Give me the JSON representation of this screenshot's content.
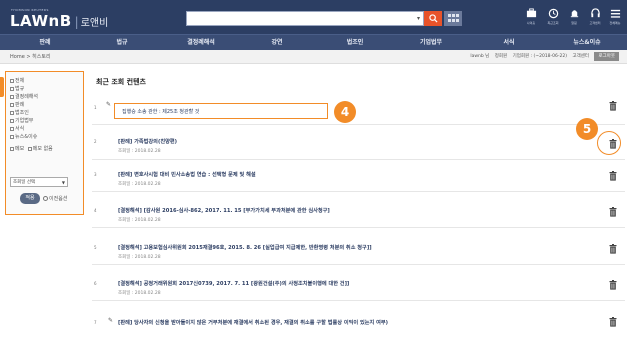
{
  "header": {
    "brand_tagline": "THOMSON REUTERS",
    "brand_name": "LAWnB",
    "brand_sep": "|",
    "brand_korean": "로앤비",
    "tools": [
      {
        "icon": "briefcase-icon",
        "label": "나의홈"
      },
      {
        "icon": "history-icon",
        "label": "최근조회"
      },
      {
        "icon": "bell-icon",
        "label": "알림"
      },
      {
        "icon": "headset-icon",
        "label": "고객센터"
      },
      {
        "icon": "menu-icon",
        "label": "전체메뉴"
      }
    ]
  },
  "nav": {
    "items": [
      "판례",
      "법규",
      "결정례해석",
      "강연",
      "법조인",
      "기업법무",
      "서식",
      "뉴스&이슈"
    ]
  },
  "breadcrumb": "Home > 히스토리",
  "userbar": {
    "user": "lawnb 님",
    "links": [
      "정회원",
      "기업회원 : (~2018-06-22)",
      "고객센터"
    ],
    "logout": "로그아웃"
  },
  "sidebar": {
    "items": [
      "전체",
      "법규",
      "결정례해석",
      "판례",
      "법조인",
      "기업법무",
      "서식",
      "뉴스&이슈"
    ],
    "extra": "메모",
    "extra2": "메모 없음",
    "select_value": "조회일 선택",
    "apply_label": "적용",
    "reset_label": "이전옵션"
  },
  "main": {
    "title": "최근 조회 컨텐츠",
    "highlight_text": "집행승 소송 관한 : 제25조 청관할 것",
    "rows": [
      {
        "num": "1",
        "title": "",
        "date": ""
      },
      {
        "num": "2",
        "title": "[판례] 가족법강의(친양편)",
        "date": "조회일 : 2018.02.28"
      },
      {
        "num": "3",
        "title": "[판례] 변호사시험 대비 민사소송법 연습 : 선택형 문제 및 해설",
        "date": "조회일 : 2018.02.28"
      },
      {
        "num": "4",
        "title": "[결정해석] [감사원 2016-심사-862, 2017. 11. 15 [부가가치세 부과처분에 관한 심사청구]",
        "date": "조회일 : 2018.02.28"
      },
      {
        "num": "5",
        "title": "[결정해석] 고용보험심사위원회 2015재결96호, 2015. 8. 26 [실업급여 지급제한, 반환명령 처분의 취소 청구]]",
        "date": "조회일 : 2018.02.28"
      },
      {
        "num": "6",
        "title": "[결정해석] 공정거래위원회 2017신0739, 2017. 7. 11 [광원건설(주)의 사정조치불이행에 대한 건]]",
        "date": "조회일 : 2018.02.28"
      },
      {
        "num": "7",
        "title": "[판례] 당사자의 신청을 받아들이지 않은 거부처분에 재결에서 취소된 경우, 재결의 취소를 구할 법률상 이익이 있는지 여부)",
        "date": ""
      }
    ]
  },
  "callouts": {
    "four": "4",
    "five": "5"
  },
  "colors": {
    "header": "#2c3e63",
    "nav": "#3a4d75",
    "accent": "#f28c28",
    "search": "#e8532a"
  }
}
